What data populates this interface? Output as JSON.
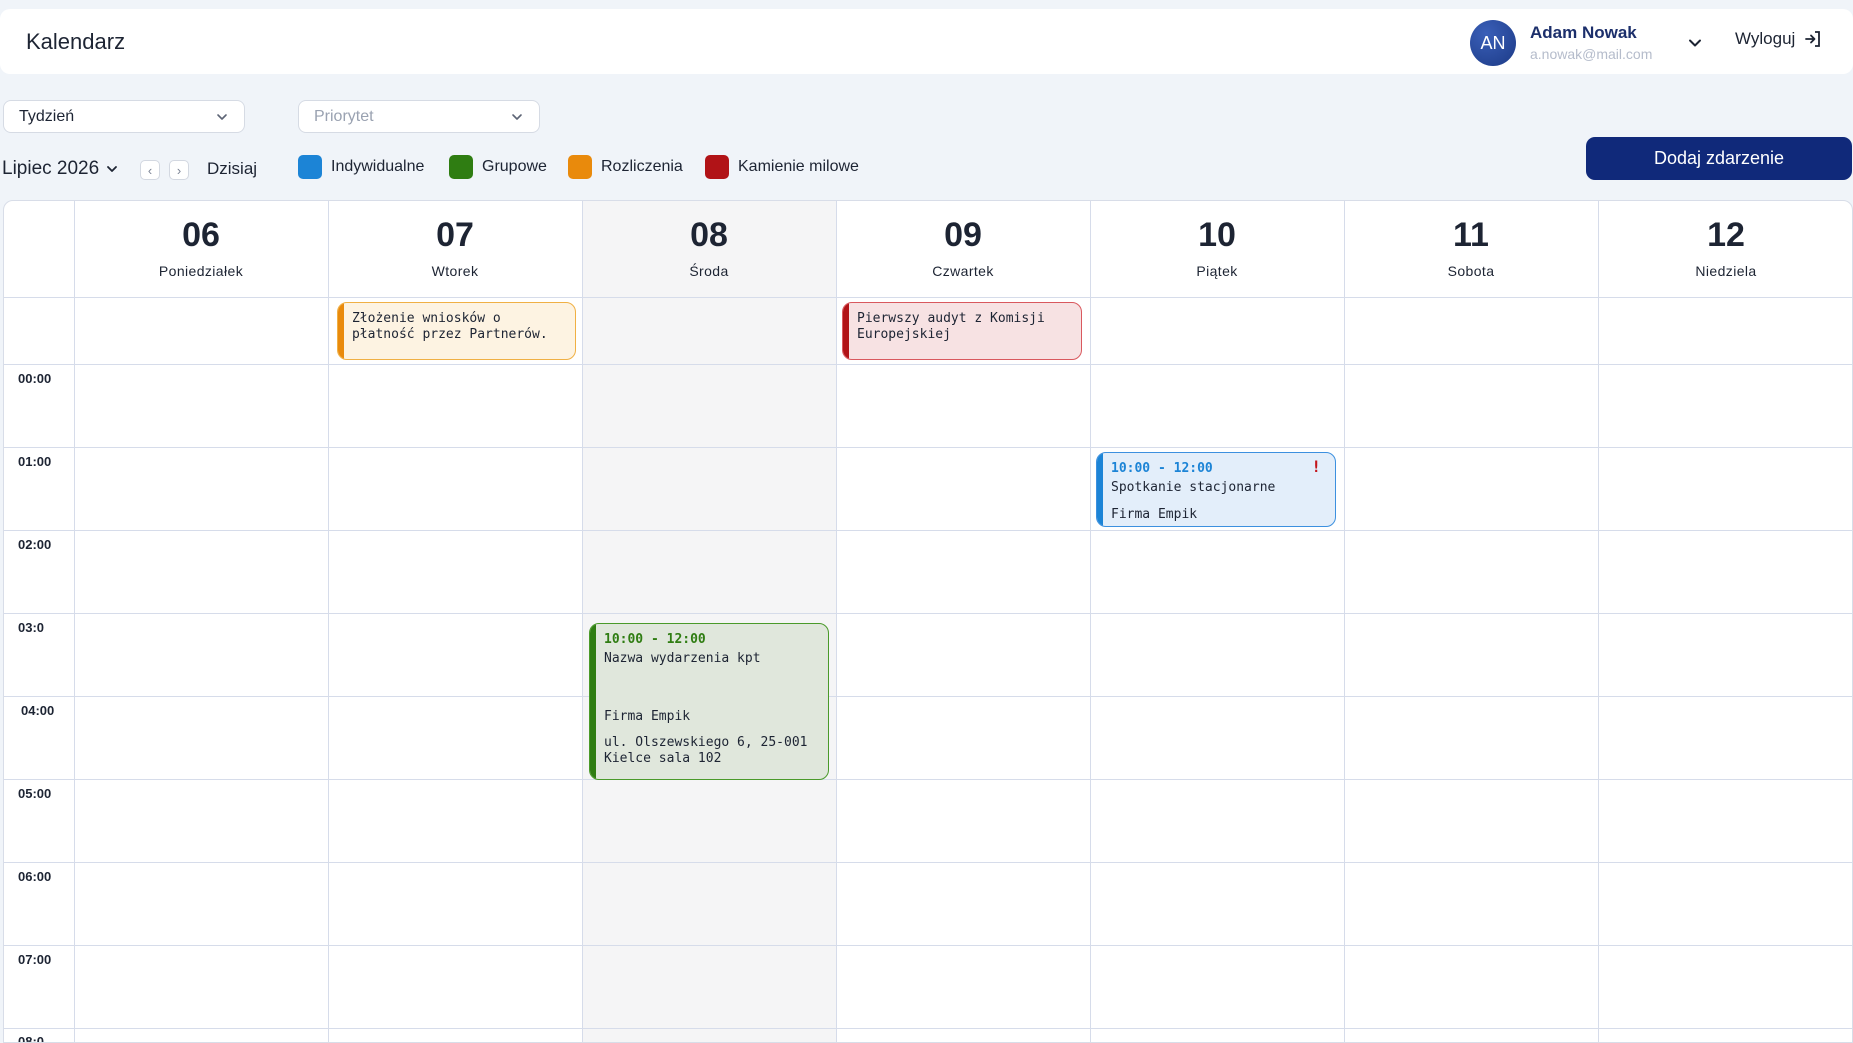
{
  "app": {
    "title": "Kalendarz"
  },
  "user": {
    "initials": "AN",
    "name": "Adam Nowak",
    "email": "a.nowak@mail.com",
    "logout_label": "Wyloguj"
  },
  "filters": {
    "period": "Tydzień",
    "priority_placeholder": "Priorytet"
  },
  "nav": {
    "month": "Lipiec 2026",
    "prev": "‹",
    "next": "›",
    "today": "Dzisiaj"
  },
  "legend": [
    {
      "label": "Indywidualne",
      "color": "#1c84d6"
    },
    {
      "label": "Grupowe",
      "color": "#2f7d12"
    },
    {
      "label": "Rozliczenia",
      "color": "#e98a0c"
    },
    {
      "label": "Kamienie milowe",
      "color": "#b11317"
    }
  ],
  "add_button": "Dodaj zdarzenie",
  "days": [
    {
      "num": "06",
      "name": "Poniedziałek"
    },
    {
      "num": "07",
      "name": "Wtorek"
    },
    {
      "num": "08",
      "name": "Środa"
    },
    {
      "num": "09",
      "name": "Czwartek"
    },
    {
      "num": "10",
      "name": "Piątek"
    },
    {
      "num": "11",
      "name": "Sobota"
    },
    {
      "num": "12",
      "name": "Niedziela"
    }
  ],
  "hours": [
    "00:00",
    "01:00",
    "02:00",
    "03:0",
    "04:00",
    "05:00",
    "06:00",
    "07:00",
    "08:0"
  ],
  "events": {
    "all_day_1": {
      "text": "Złożenie wniosków o płatność przez Partnerów."
    },
    "all_day_2": {
      "text": "Pierwszy audyt z Komisji Europejskiej"
    },
    "meeting": {
      "time": "10:00 - 12:00",
      "title": "Spotkanie stacjonarne",
      "company": "Firma Empik",
      "priority": "!"
    },
    "group": {
      "time": "10:00 - 12:00",
      "title": "Nazwa wydarzenia kpt",
      "company": "Firma Empik",
      "address": "ul. Olszewskiego 6, 25-001 Kielce sala 102"
    }
  }
}
